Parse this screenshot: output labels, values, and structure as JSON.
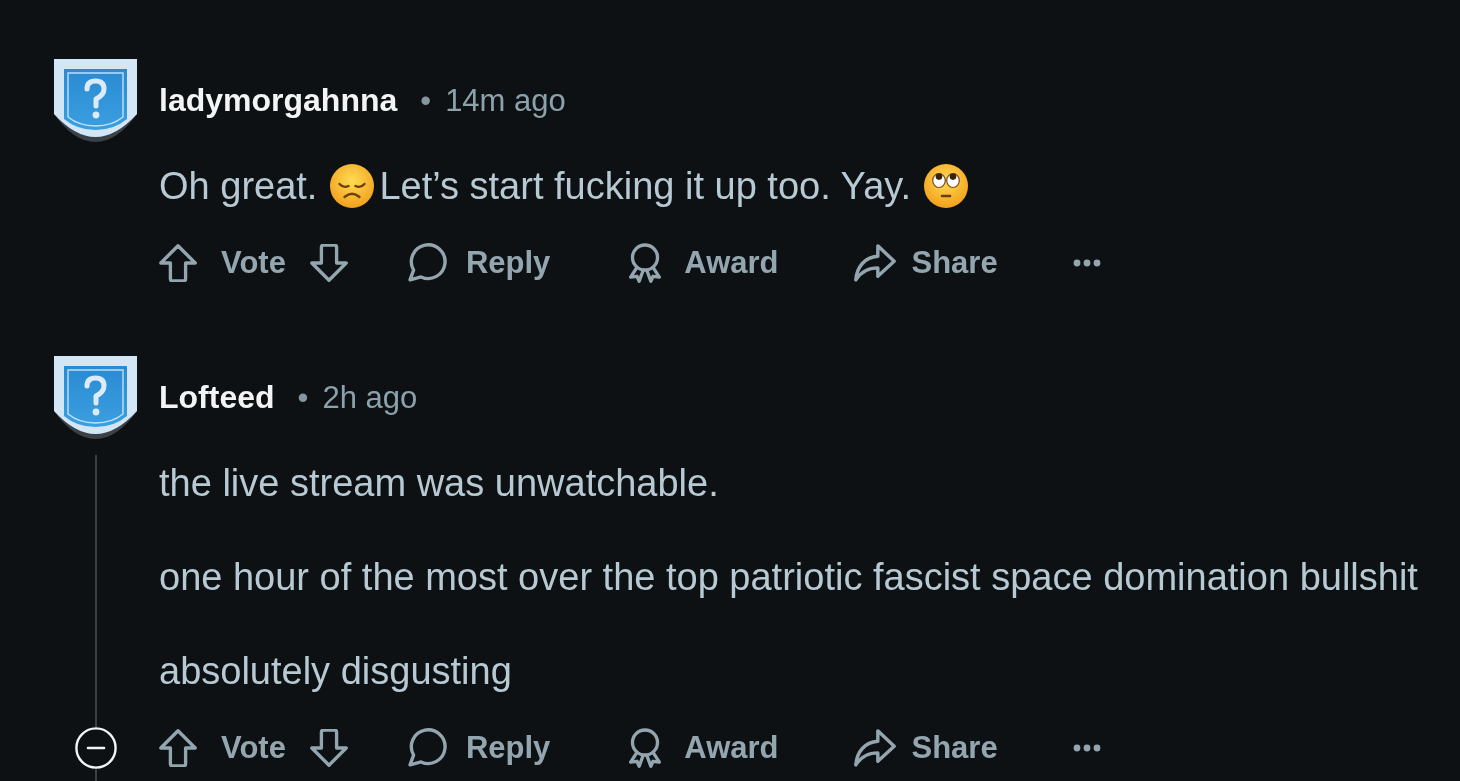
{
  "comments": [
    {
      "author": "ladymorgahnna",
      "separator": "•",
      "time": "14m ago",
      "body": [
        [
          {
            "kind": "text",
            "text": "Oh great."
          },
          {
            "kind": "sad"
          },
          {
            "kind": "text",
            "text": "Let’s start fucking it up too. Yay."
          },
          {
            "kind": "eyeroll"
          }
        ]
      ],
      "actions": [
        {
          "kind": "vote",
          "label": "Vote"
        },
        {
          "kind": "reply",
          "label": "Reply"
        },
        {
          "kind": "award",
          "label": "Award"
        },
        {
          "kind": "share",
          "label": "Share"
        },
        {
          "kind": "more"
        }
      ]
    },
    {
      "author": "Lofteed",
      "separator": "•",
      "time": "2h ago",
      "thread": {
        "expanded": true
      },
      "body": [
        [
          {
            "kind": "text",
            "text": "the live stream was unwatchable."
          }
        ],
        [
          {
            "kind": "text",
            "text": "one hour of the most over the top patriotic fascist space domination bullshit"
          }
        ],
        [
          {
            "kind": "text",
            "text": "absolutely disgusting"
          }
        ]
      ],
      "actions": [
        {
          "kind": "vote",
          "label": "Vote"
        },
        {
          "kind": "reply",
          "label": "Reply"
        },
        {
          "kind": "award",
          "label": "Award"
        },
        {
          "kind": "share",
          "label": "Share"
        },
        {
          "kind": "more"
        }
      ]
    }
  ]
}
